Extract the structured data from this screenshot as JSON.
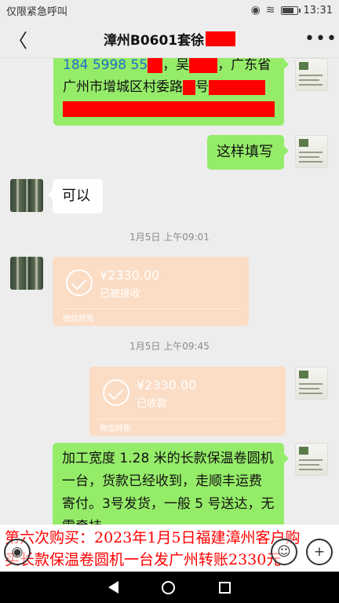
{
  "status_bar": {
    "left_text": "仅限紧急呼叫",
    "time": "13:31",
    "battery_level": 0.85
  },
  "header": {
    "title": "漳州B0601套徐"
  },
  "messages": [
    {
      "type": "text",
      "side": "right",
      "lines": [
        "184 5998 55",
        "，吴",
        "，广东省",
        "广州市增城区村委路",
        "号"
      ]
    },
    {
      "type": "text",
      "side": "right",
      "text": "这样填写"
    },
    {
      "type": "text",
      "side": "left",
      "text": "可以"
    },
    {
      "type": "time",
      "text": "1月5日 上午09:01"
    },
    {
      "type": "transfer",
      "side": "left",
      "amount": "¥2330.00",
      "status": "已被接收",
      "label": "微信转账"
    },
    {
      "type": "time",
      "text": "1月5日 上午09:45"
    },
    {
      "type": "transfer",
      "side": "right",
      "amount": "¥2330.00",
      "status": "已收款",
      "label": "微信转账"
    },
    {
      "type": "text",
      "side": "right",
      "text": "加工宽度 1.28 米的长款保温卷圆机一台，货款已经收到，走顺丰运费寄付。3号发货，一般 5 号送达，无需牵挂。"
    }
  ],
  "caption": {
    "line1": "第六次购买：2023年1月5日福建漳州客户购",
    "line2": "买长款保温卷圆机一台发广州转账2330元"
  },
  "icons": [
    "back-icon",
    "more-icon",
    "voice-icon",
    "emoji-icon",
    "plus-icon",
    "nav-back-icon",
    "nav-home-icon",
    "nav-recent-icon"
  ]
}
